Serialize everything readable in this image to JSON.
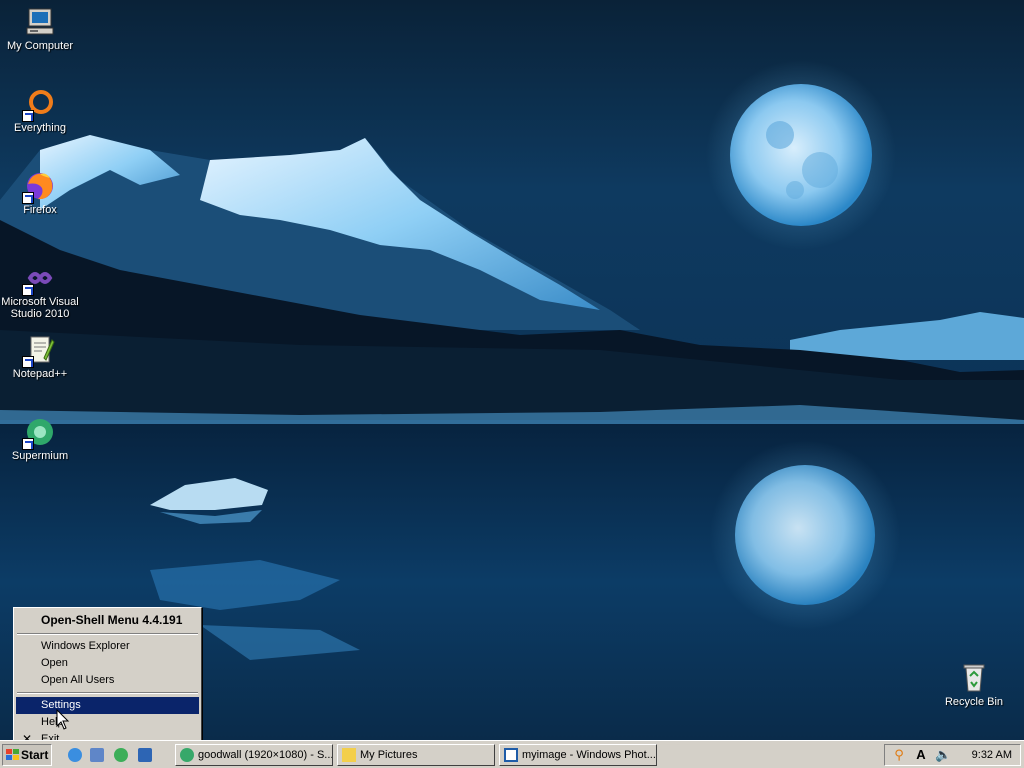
{
  "desktop": {
    "icons": [
      {
        "label": "My Computer",
        "icon": "my-computer-icon"
      },
      {
        "label": "Everything",
        "icon": "everything-icon"
      },
      {
        "label": "Firefox",
        "icon": "firefox-icon"
      },
      {
        "label": "Microsoft Visual Studio 2010",
        "icon": "visual-studio-icon"
      },
      {
        "label": "Notepad++",
        "icon": "notepad-plus-plus-icon"
      },
      {
        "label": "Supermium",
        "icon": "supermium-icon"
      },
      {
        "label": "Recycle Bin",
        "icon": "recycle-bin-icon"
      }
    ],
    "wallpaper": "night-mountain-lake-full-moon"
  },
  "context_menu": {
    "header": "Open-Shell Menu 4.4.191",
    "items": [
      {
        "label": "Windows Explorer"
      },
      {
        "label": "Open"
      },
      {
        "label": "Open All Users"
      },
      {
        "label": "Settings",
        "selected": true
      },
      {
        "label": "Help"
      },
      {
        "label": "Exit",
        "icon": "close-x-icon"
      }
    ]
  },
  "taskbar": {
    "start_label": "Start",
    "quick_launch": [
      "internet-explorer-icon",
      "show-desktop-icon",
      "refresh-icon",
      "window-switch-icon"
    ],
    "tasks": [
      {
        "label": "goodwall (1920×1080) - S...",
        "icon": "image-viewer-icon"
      },
      {
        "label": "My Pictures",
        "icon": "folder-icon"
      },
      {
        "label": "myimage - Windows Phot...",
        "icon": "photo-viewer-icon"
      }
    ],
    "tray": {
      "icons": [
        "search-icon",
        "language-icon",
        "volume-icon"
      ],
      "clock": "9:32 AM"
    }
  },
  "colors": {
    "selection": "#0a246a",
    "face": "#d4d0c8",
    "sky": "#0b2a48"
  }
}
